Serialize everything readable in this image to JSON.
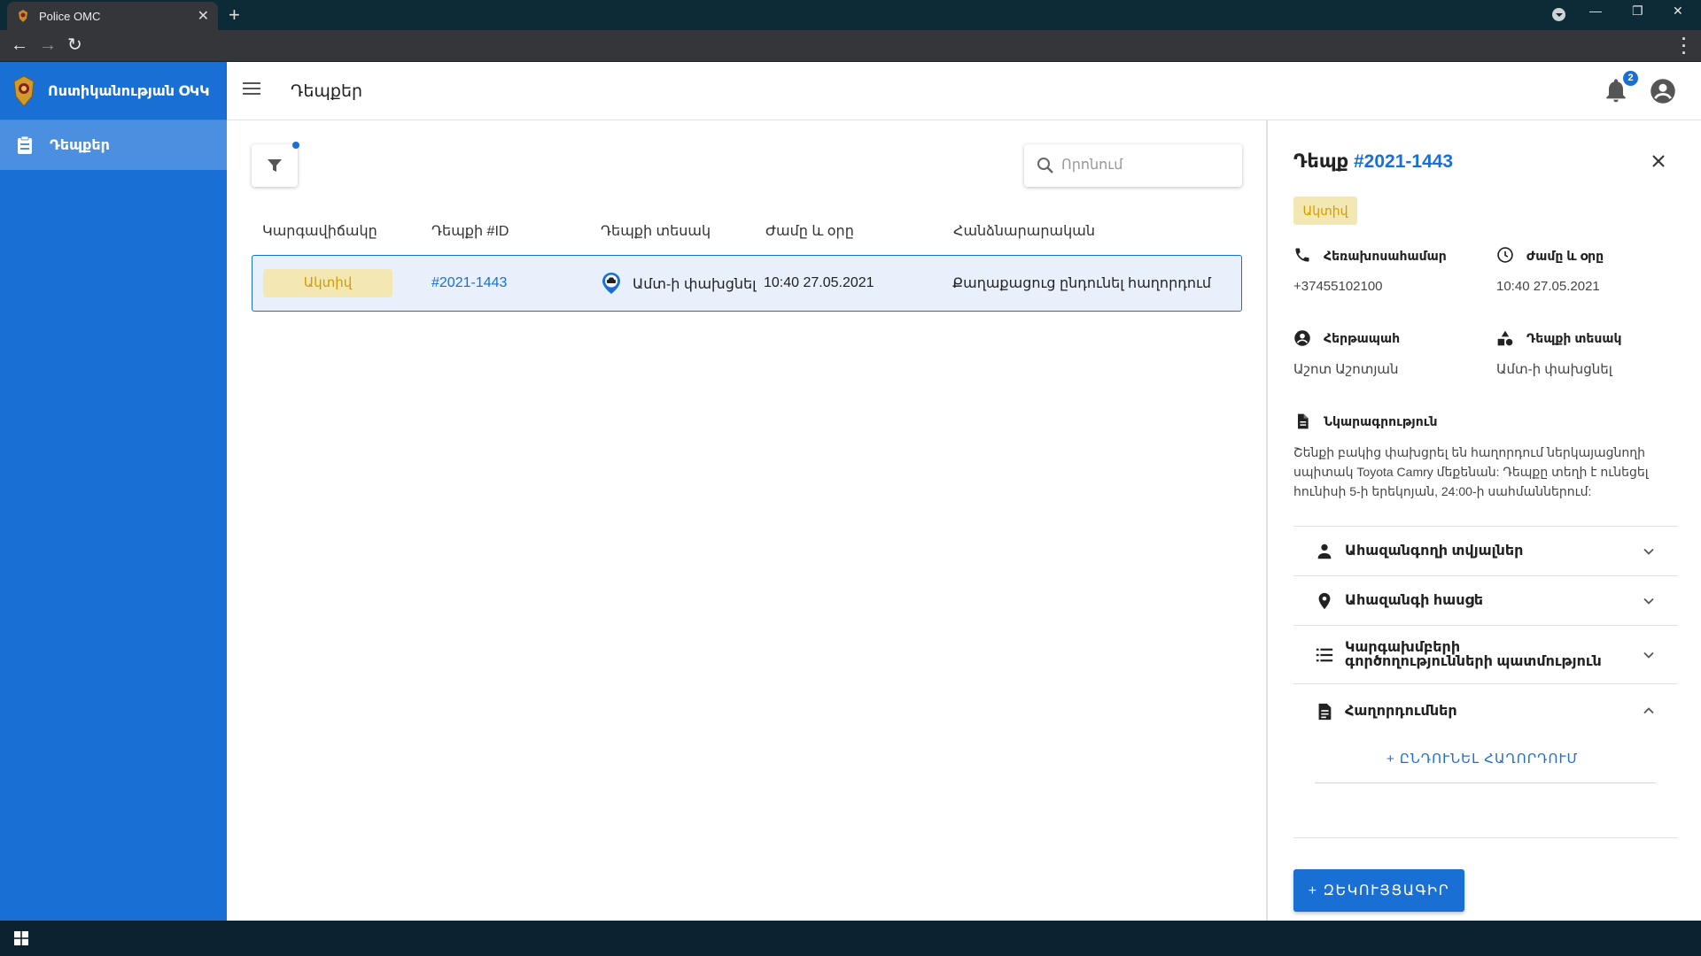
{
  "browser": {
    "tab_title": "Police OMC",
    "tab_close": "✕",
    "new_tab": "+",
    "window_controls": {
      "minimize": "—",
      "restore": "❐",
      "close": "✕"
    }
  },
  "sidebar": {
    "brand": "Ոստիկանության ՕԿԿ",
    "items": [
      {
        "label": "Դեպքեր",
        "icon": "clipboard-icon",
        "active": true
      }
    ]
  },
  "header": {
    "title": "Դեպքեր",
    "notification_count": "2"
  },
  "search": {
    "placeholder": "Որոնում"
  },
  "table": {
    "columns": [
      "Կարգավիճակը",
      "Դեպքի #ID",
      "Դեպքի տեսակ",
      "Ժամը և օրը",
      "Հանձնարարական"
    ],
    "rows": [
      {
        "status": "Ակտիվ",
        "id": "#2021-1443",
        "type": "Ամտ-ի փախցնել",
        "datetime": "10:40 27.05.2021",
        "assignment": "Քաղաքացուց ընդունել հաղորդում"
      }
    ]
  },
  "panel": {
    "title_prefix": "Դեպք",
    "case_id": "#2021-1443",
    "status": "Ակտիվ",
    "phone_label": "Հեռախոսահամար",
    "phone_value": "+37455102100",
    "datetime_label": "Ժամը և օրը",
    "datetime_value": "10:40 27.05.2021",
    "reporter_label": "Հերթապահ",
    "reporter_value": "Աշոտ Աշոտյան",
    "type_label": "Դեպքի տեսակ",
    "type_value": "Ամտ-ի փախցնել",
    "description_label": "Նկարագրություն",
    "description": "Շենքի բակից փախցրել են հաղորդում ներկայացնողի սպիտակ Toyota Camry մեքենան: Դեպքը տեղի է ունեցել հունիսի 5-ի երեկոյան, 24:00-ի սահմաններում:",
    "sections": [
      {
        "label": "Ահազանգողի տվյալներ",
        "icon": "person-icon",
        "expanded": false
      },
      {
        "label": "Ահազանգի հասցե",
        "icon": "location-pin-icon",
        "expanded": false
      },
      {
        "label": "Կարգախմբերի գործողությունների պատմություն",
        "icon": "list-icon",
        "expanded": false
      },
      {
        "label": "Հաղորդումներ",
        "icon": "document-icon",
        "expanded": true
      }
    ],
    "add_report_label": "+ ԸՆԴՈՒՆԵԼ ՀԱՂՈՐԴՈՒՄ",
    "report_button_label": "+ ԶԵԿՈՒՅՑԱԳԻՐ"
  },
  "colors": {
    "primary": "#1a6fd4",
    "sidebar_active": "#4b8fe0",
    "status_bg": "#f3e8b4",
    "status_text": "#d69a00",
    "row_highlight": "#e8f0fb"
  }
}
